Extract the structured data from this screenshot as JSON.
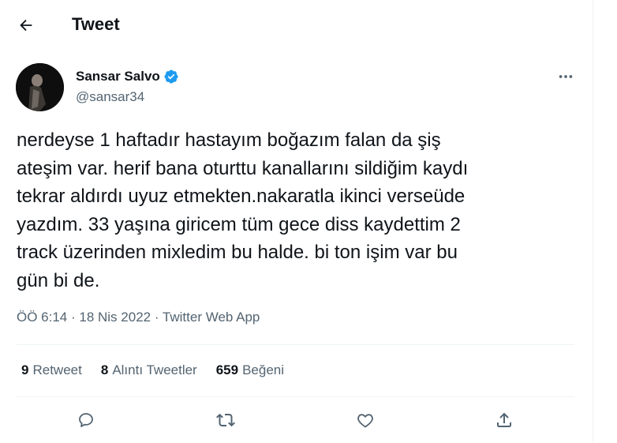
{
  "header": {
    "title": "Tweet",
    "back_icon": "arrow-left-icon"
  },
  "author": {
    "name": "Sansar Salvo",
    "handle": "@sansar34",
    "verified_color": "#1d9bf0",
    "more_icon": "more-horizontal-icon"
  },
  "tweet": {
    "text": "nerdeyse 1 haftadır hastayım boğazım falan da şiş\nateşim var. herif bana oturttu kanallarını sildiğim kaydı\ntekrar aldırdı uyuz etmekten.nakaratla ikinci verseüde\nyazdım. 33 yaşına giricem tüm gece diss kaydettim 2\ntrack üzerinden mixledim bu halde. bi ton işim var bu\ngün bi de.",
    "time": "ÖÖ 6:14",
    "separator": " · ",
    "date": "18 Nis 2022",
    "source": "Twitter Web App"
  },
  "stats": {
    "retweets_count": "9",
    "retweets_label": "Retweet",
    "quotes_count": "8",
    "quotes_label": "Alıntı Tweetler",
    "likes_count": "659",
    "likes_label": "Beğeni"
  },
  "actions": [
    "reply-icon",
    "retweet-icon",
    "like-icon",
    "share-icon"
  ],
  "colors": {
    "text": "#0f1419",
    "secondary": "#536471",
    "divider": "#eff3f4",
    "accent": "#1d9bf0"
  }
}
